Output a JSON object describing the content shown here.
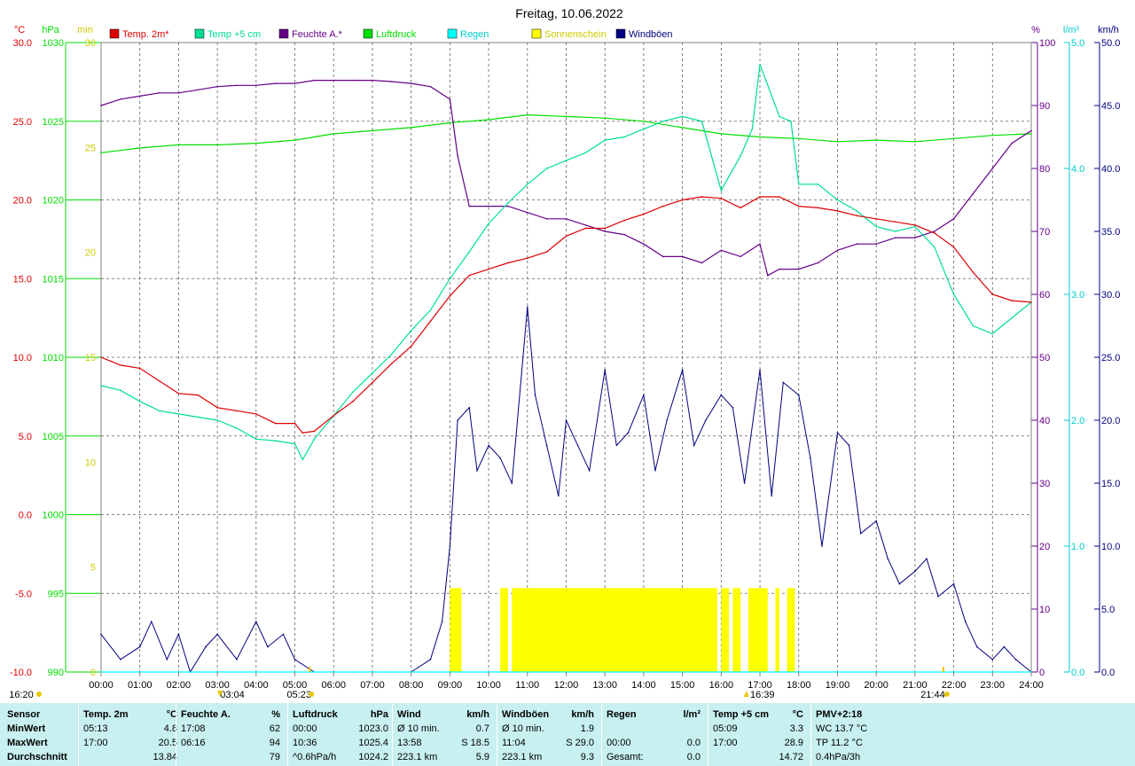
{
  "title": "Freitag, 10.06.2022",
  "colors": {
    "temp2m": "#dd0000",
    "temp5cm": "#00dd99",
    "humidity": "#660088",
    "pressure": "#00dd00",
    "rain": "#00ffff",
    "sun": "#ffff00",
    "wind": "#000080",
    "stats_bg": "#c8f0f0"
  },
  "axes": {
    "left_units": {
      "temp": "°C",
      "pressure": "hPa",
      "min": "min"
    },
    "right_units": {
      "humidity": "%",
      "rain": "l/m²",
      "wind": "km/h"
    },
    "temp_ticks": [
      "30.0",
      "25.0",
      "20.0",
      "15.0",
      "10.0",
      "5.0",
      "0.0",
      "-5.0",
      "-10.0"
    ],
    "pressure_ticks": [
      "1030",
      "1025",
      "1020",
      "1015",
      "1010",
      "1005",
      "1000",
      "995",
      "990"
    ],
    "min_ticks": [
      "30",
      "25",
      "20",
      "15",
      "10",
      "5",
      "0"
    ],
    "humidity_ticks": [
      "100",
      "90",
      "80",
      "70",
      "60",
      "50",
      "40",
      "30",
      "20",
      "10",
      "0"
    ],
    "rain_ticks": [
      "5.0",
      "4.0",
      "3.0",
      "2.0",
      "1.0",
      "0.0"
    ],
    "wind_ticks": [
      "50.0",
      "45.0",
      "40.0",
      "35.0",
      "30.0",
      "25.0",
      "20.0",
      "15.0",
      "10.0",
      "5.0",
      "0.0"
    ],
    "x_ticks": [
      "00:00",
      "01:00",
      "02:00",
      "03:00",
      "04:00",
      "05:00",
      "06:00",
      "07:00",
      "08:00",
      "09:00",
      "10:00",
      "11:00",
      "12:00",
      "13:00",
      "14:00",
      "15:00",
      "16:00",
      "17:00",
      "18:00",
      "19:00",
      "20:00",
      "21:00",
      "22:00",
      "23:00",
      "24:00"
    ]
  },
  "markers": {
    "moonset": "16:20",
    "temp_min_label": "03:04",
    "sunrise": "05:23",
    "temp_max_label": "16:39",
    "sunset": "21:44"
  },
  "chart_data": {
    "type": "line",
    "title": "Freitag, 10.06.2022",
    "xlabel": "",
    "x_unit": "hours",
    "xlim": [
      0,
      24
    ],
    "grid": true,
    "legend_position": "top",
    "series": [
      {
        "name": "Temp. 2m*",
        "key": "temp2m",
        "axis": "temp",
        "ylim": [
          -10,
          30
        ],
        "x": [
          0,
          0.5,
          1,
          1.5,
          2,
          2.5,
          3,
          3.5,
          4,
          4.5,
          5,
          5.2,
          5.5,
          6,
          6.5,
          7,
          7.5,
          8,
          8.5,
          9,
          9.5,
          10,
          10.5,
          11,
          11.5,
          12,
          12.5,
          13,
          13.5,
          14,
          14.5,
          15,
          15.5,
          16,
          16.5,
          17,
          17.5,
          18,
          18.5,
          19,
          19.5,
          20,
          20.5,
          21,
          21.5,
          22,
          22.5,
          23,
          23.5,
          24
        ],
        "y": [
          10.0,
          9.5,
          9.3,
          8.5,
          7.7,
          7.6,
          6.8,
          6.6,
          6.4,
          5.8,
          5.8,
          5.2,
          5.3,
          6.3,
          7.2,
          8.4,
          9.6,
          10.7,
          12.3,
          13.9,
          15.2,
          15.6,
          16.0,
          16.3,
          16.7,
          17.7,
          18.2,
          18.2,
          18.7,
          19.1,
          19.6,
          20.0,
          20.2,
          20.1,
          19.5,
          20.2,
          20.2,
          19.6,
          19.5,
          19.3,
          19.0,
          18.8,
          18.6,
          18.4,
          17.9,
          17.0,
          15.4,
          14.0,
          13.6,
          13.5
        ]
      },
      {
        "name": "Temp +5 cm",
        "key": "temp5cm",
        "axis": "temp",
        "ylim": [
          -10,
          30
        ],
        "x": [
          0,
          0.5,
          1,
          1.5,
          2,
          2.5,
          3,
          3.5,
          4,
          4.5,
          5,
          5.2,
          5.5,
          6,
          6.5,
          7,
          7.5,
          8,
          8.5,
          9,
          9.5,
          10,
          10.5,
          11,
          11.5,
          12,
          12.5,
          13,
          13.5,
          14,
          14.5,
          15,
          15.5,
          16,
          16.2,
          16.5,
          16.8,
          17,
          17.2,
          17.5,
          17.8,
          18,
          18.5,
          19,
          19.5,
          20,
          20.5,
          21,
          21.5,
          22,
          22.5,
          23,
          23.5,
          24
        ],
        "y": [
          8.2,
          7.9,
          7.2,
          6.6,
          6.4,
          6.2,
          6.0,
          5.5,
          4.8,
          4.7,
          4.5,
          3.5,
          4.8,
          6.3,
          7.8,
          9.0,
          10.2,
          11.7,
          13.0,
          15.0,
          16.7,
          18.5,
          19.8,
          21.0,
          22.0,
          22.5,
          23.0,
          23.8,
          24.0,
          24.5,
          25.0,
          25.3,
          25.0,
          20.6,
          21.5,
          22.8,
          24.5,
          28.6,
          27.3,
          25.3,
          25.0,
          21.0,
          21.0,
          20.0,
          19.3,
          18.3,
          18.0,
          18.3,
          17.0,
          14.0,
          12.0,
          11.5,
          12.5,
          13.5
        ]
      },
      {
        "name": "Feuchte A.*",
        "key": "humidity",
        "axis": "humidity",
        "ylim": [
          0,
          100
        ],
        "x": [
          0,
          0.5,
          1,
          1.5,
          2,
          2.5,
          3,
          3.5,
          4,
          4.5,
          5,
          5.5,
          6,
          6.5,
          7,
          7.5,
          8,
          8.5,
          9,
          9.2,
          9.5,
          10,
          10.5,
          11,
          11.5,
          12,
          12.5,
          13,
          13.5,
          14,
          14.5,
          15,
          15.5,
          16,
          16.5,
          17,
          17.2,
          17.5,
          18,
          18.5,
          19,
          19.5,
          20,
          20.5,
          21,
          21.5,
          22,
          22.5,
          23,
          23.5,
          24
        ],
        "y": [
          90,
          91,
          91.5,
          92,
          92,
          92.5,
          93,
          93.2,
          93.2,
          93.5,
          93.5,
          94,
          94,
          94,
          94,
          93.8,
          93.5,
          93,
          91,
          82,
          74,
          74,
          74,
          73,
          72,
          72,
          71,
          70,
          69.5,
          68,
          66,
          66,
          65,
          67,
          66,
          68,
          63,
          64,
          64,
          65,
          67,
          68,
          68,
          69,
          69,
          70,
          72,
          76,
          80,
          84,
          86
        ]
      },
      {
        "name": "Luftdruck",
        "key": "pressure",
        "axis": "pressure",
        "ylim": [
          990,
          1030
        ],
        "x": [
          0,
          1,
          2,
          3,
          4,
          5,
          6,
          7,
          8,
          9,
          10,
          11,
          12,
          13,
          14,
          15,
          16,
          17,
          18,
          19,
          20,
          21,
          22,
          23,
          24
        ],
        "y": [
          1023.0,
          1023.3,
          1023.5,
          1023.5,
          1023.6,
          1023.8,
          1024.2,
          1024.4,
          1024.6,
          1024.9,
          1025.1,
          1025.4,
          1025.3,
          1025.2,
          1025.0,
          1024.6,
          1024.2,
          1024.0,
          1023.9,
          1023.7,
          1023.8,
          1023.7,
          1023.9,
          1024.1,
          1024.2
        ]
      },
      {
        "name": "Regen",
        "key": "rain",
        "axis": "rain",
        "ylim": [
          0,
          5
        ],
        "x": [
          0,
          24
        ],
        "y": [
          0,
          0
        ]
      },
      {
        "name": "Windböen",
        "key": "wind",
        "axis": "wind",
        "ylim": [
          0,
          50
        ],
        "x": [
          0,
          0.5,
          1,
          1.3,
          1.7,
          2,
          2.3,
          2.7,
          3,
          3.5,
          4,
          4.3,
          4.7,
          5,
          5.5,
          6,
          6.5,
          7,
          7.5,
          8,
          8.5,
          8.8,
          9,
          9.2,
          9.5,
          9.7,
          10,
          10.3,
          10.6,
          11,
          11.2,
          11.5,
          11.8,
          12,
          12.3,
          12.6,
          13,
          13.3,
          13.6,
          14,
          14.3,
          14.6,
          15,
          15.3,
          15.6,
          16,
          16.3,
          16.6,
          17,
          17.3,
          17.6,
          18,
          18.3,
          18.6,
          19,
          19.3,
          19.6,
          20,
          20.3,
          20.6,
          21,
          21.3,
          21.6,
          22,
          22.3,
          22.6,
          23,
          23.3,
          23.6,
          24
        ],
        "y": [
          3,
          1,
          2,
          4,
          1,
          3,
          0,
          2,
          3,
          1,
          4,
          2,
          3,
          1,
          0,
          0,
          0,
          0,
          0,
          0,
          1,
          4,
          10,
          20,
          21,
          16,
          18,
          17,
          15,
          29,
          22,
          18,
          14,
          20,
          18,
          16,
          24,
          18,
          19,
          22,
          16,
          20,
          24,
          18,
          20,
          22,
          21,
          15,
          24,
          14,
          23,
          22,
          17,
          10,
          19,
          18,
          11,
          12,
          9,
          7,
          8,
          9,
          6,
          7,
          4,
          2,
          1,
          2,
          1,
          0
        ]
      }
    ],
    "sunshine": {
      "name": "Sonnenschein",
      "key": "sun",
      "axis": "min",
      "intervals": [
        [
          9.0,
          9.3
        ],
        [
          10.3,
          10.5
        ],
        [
          10.6,
          15.9
        ],
        [
          16.0,
          16.2
        ],
        [
          16.3,
          16.5
        ],
        [
          16.7,
          17.2
        ],
        [
          17.4,
          17.5
        ],
        [
          17.7,
          17.9
        ]
      ]
    }
  },
  "stats": {
    "row_labels": [
      "Sensor",
      "MinWert",
      "MaxWert",
      "Durchschnitt"
    ],
    "columns": [
      {
        "title": "Temp. 2m",
        "unit": "°C",
        "rows": [
          [
            "05:13",
            "4.8"
          ],
          [
            "17:00",
            "20.5"
          ],
          [
            "",
            "13.84"
          ]
        ]
      },
      {
        "title": "Feuchte A.",
        "unit": "%",
        "rows": [
          [
            "17:08",
            "62"
          ],
          [
            "06:16",
            "94"
          ],
          [
            "",
            "79"
          ]
        ]
      },
      {
        "title": "Luftdruck",
        "unit": "hPa",
        "rows": [
          [
            "00:00",
            "1023.0"
          ],
          [
            "10:36",
            "1025.4"
          ],
          [
            "^0.6hPa/h",
            "1024.2"
          ]
        ]
      },
      {
        "title": "Wind",
        "unit": "km/h",
        "rows": [
          [
            "Ø 10 min.",
            "0.7"
          ],
          [
            "13:58",
            "S 18.5"
          ],
          [
            "223.1 km",
            "5.9"
          ]
        ]
      },
      {
        "title": "Windböen",
        "unit": "km/h",
        "rows": [
          [
            "Ø 10 min.",
            "1.9"
          ],
          [
            "11:04",
            "S 29.0"
          ],
          [
            "223.1 km",
            "9.3"
          ]
        ]
      },
      {
        "title": "Regen",
        "unit": "l/m²",
        "rows": [
          [
            "",
            ""
          ],
          [
            "00:00",
            "0.0"
          ],
          [
            "Gesamt:",
            "0.0"
          ]
        ]
      },
      {
        "title": "Temp +5 cm",
        "unit": "°C",
        "rows": [
          [
            "05:09",
            "3.3"
          ],
          [
            "17:00",
            "28.9"
          ],
          [
            "",
            "14.72"
          ]
        ]
      }
    ],
    "pmv": {
      "title": "PMV+2:18",
      "lines": [
        "WC 13.7 °C",
        "TP 11.2 °C",
        "0.4hPa/3h"
      ]
    }
  }
}
